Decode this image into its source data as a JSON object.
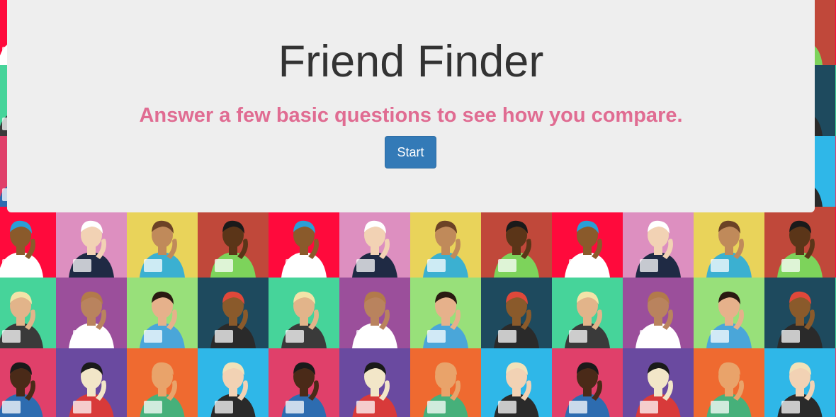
{
  "jumbotron": {
    "title": "Friend Finder",
    "subtitle": "Answer a few basic questions to see how you compare.",
    "start_label": "Start"
  },
  "colors": {
    "title": "#333333",
    "subtitle": "#e06c92",
    "button": "#337ab7",
    "panel": "#eeeeee"
  },
  "background": {
    "tiles": [
      {
        "bg": "#ff0a3c",
        "figure": "cap-kid-reading-paper",
        "skin": "#8a5a2b",
        "hair": "#2a9fd6",
        "shirt": "#ffffff"
      },
      {
        "bg": "#dd8fc0",
        "figure": "suit-man-laptop",
        "skin": "#f2d2b4",
        "hair": "#ffffff",
        "shirt": "#1f2a44"
      },
      {
        "bg": "#e9d35a",
        "figure": "woman-phone-necklace",
        "skin": "#c08a5a",
        "hair": "#6b4226",
        "shirt": "#3bb0d1"
      },
      {
        "bg": "#c0483a",
        "figure": "ponytail-girl-phone",
        "skin": "#5b3518",
        "hair": "#1a1a1a",
        "shirt": "#7dd35b"
      },
      {
        "bg": "#46d49a",
        "figure": "blonde-man-phone",
        "skin": "#e2b48a",
        "hair": "#f3e3a8",
        "shirt": "#3a3a3a"
      },
      {
        "bg": "#9b4f9b",
        "figure": "woman-tablet",
        "skin": "#b9835e",
        "hair": "#b27a4b",
        "shirt": "#ffffff"
      },
      {
        "bg": "#98e07a",
        "figure": "man-laptop-green",
        "skin": "#e6b18b",
        "hair": "#2a1a12",
        "shirt": "#4aa6d9"
      },
      {
        "bg": "#1e4a5e",
        "figure": "redcap-reader",
        "skin": "#8a5a2b",
        "hair": "#e0483a",
        "shirt": "#2a2a2a"
      },
      {
        "bg": "#e0406a",
        "figure": "bearded-man-laptop",
        "skin": "#4a2a18",
        "hair": "#1a1a1a",
        "shirt": "#2d6cb0"
      },
      {
        "bg": "#6a4aa0",
        "figure": "bun-woman-phone",
        "skin": "#f2e6c8",
        "hair": "#1a1a1a",
        "shirt": "#d83a3a"
      },
      {
        "bg": "#ef6a30",
        "figure": "bald-man-tablet",
        "skin": "#e9a36a",
        "hair": "#e9a36a",
        "shirt": "#46b07a"
      },
      {
        "bg": "#2fb7e8",
        "figure": "blonde-woman-paper",
        "skin": "#f2d2b4",
        "hair": "#f1e2b9",
        "shirt": "#2a2a2a"
      }
    ]
  }
}
